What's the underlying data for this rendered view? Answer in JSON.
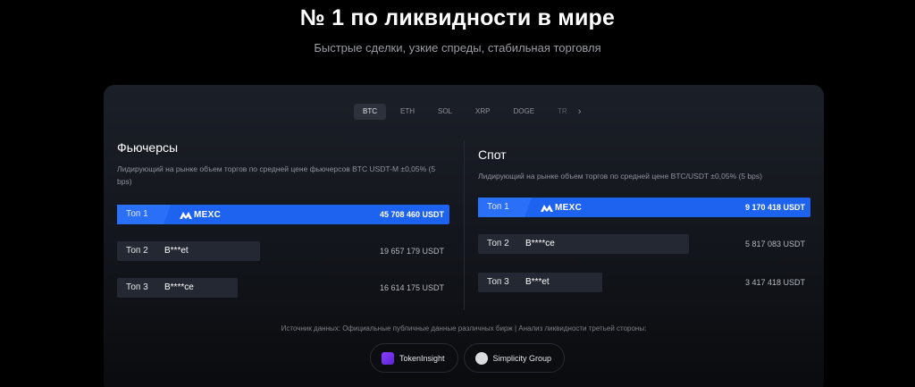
{
  "hero": {
    "title": "№ 1 по ликвидности в мире",
    "subtitle": "Быстрые сделки, узкие спреды, стабильная торговля"
  },
  "coin_tabs": [
    "BTC",
    "ETH",
    "SOL",
    "XRP",
    "DOGE",
    "TR"
  ],
  "active_tab": "BTC",
  "futures": {
    "title": "Фьючерсы",
    "description": "Лидирующий на рынке объем торгов по средней цене фьючерсов BTC USDT-M ±0,05% (5 bps)",
    "rows": [
      {
        "rank": "Топ 1",
        "name": "MEXC",
        "value": "45 708 460 USDT",
        "share": 1.0
      },
      {
        "rank": "Топ 2",
        "name": "B***et",
        "value": "19 657 179 USDT",
        "share": 0.43
      },
      {
        "rank": "Топ 3",
        "name": "B****ce",
        "value": "16 614 175 USDT",
        "share": 0.363
      }
    ]
  },
  "spot": {
    "title": "Спот",
    "description": "Лидирующий на рынке объем торгов по средней цене BTC/USDT ±0,05% (5 bps)",
    "rows": [
      {
        "rank": "Топ 1",
        "name": "MEXC",
        "value": "9 170 418 USDT",
        "share": 1.0
      },
      {
        "rank": "Топ 2",
        "name": "B****ce",
        "value": "5 817 083 USDT",
        "share": 0.634
      },
      {
        "rank": "Топ 3",
        "name": "B***et",
        "value": "3 417 418 USDT",
        "share": 0.373
      }
    ]
  },
  "source_text": "Источник данных: Официальные публичные данные различных бирж  |  Анализ ликвидности третьей стороны:",
  "partners": [
    "TokenInsight",
    "Simplicity Group"
  ],
  "colors": {
    "accent": "#1e62f0",
    "bar": "#232832",
    "background": "#000000"
  },
  "icons": {
    "next": "chevron-right-icon",
    "mexc": "mexc-logo-icon",
    "tokeninsight": "tokeninsight-logo-icon",
    "simplicity": "simplicity-group-logo-icon"
  }
}
